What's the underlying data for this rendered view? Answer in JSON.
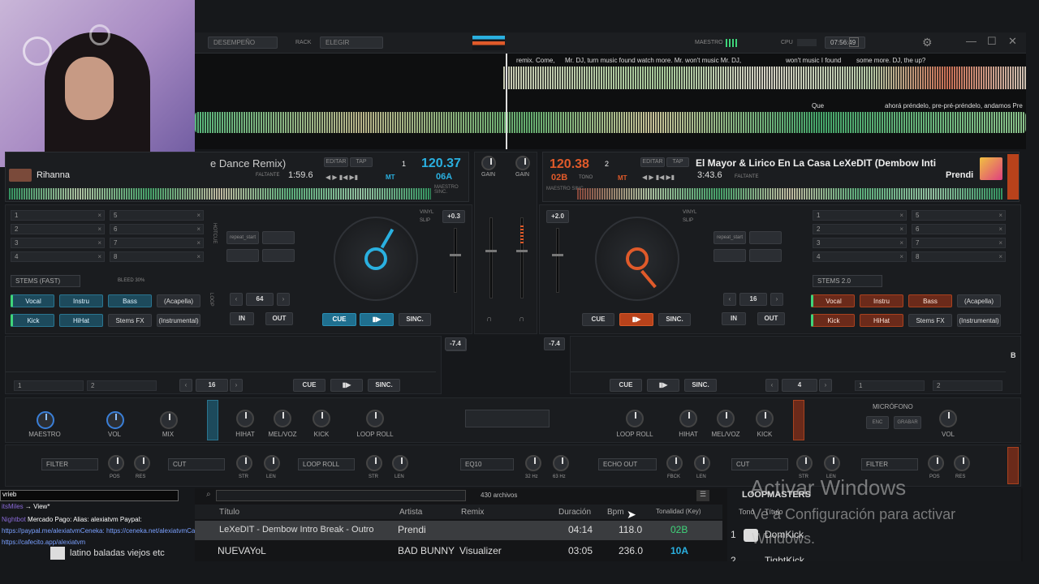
{
  "topbar": {
    "perf_dropdown": "DESEMPEÑO",
    "rack_label": "RACK",
    "rack_dropdown": "ELEGIR",
    "master_label": "MAESTRO",
    "cpu_label": "CPU",
    "clock": "07:56:49"
  },
  "wave_lyrics": {
    "top_left": "remix. Come,",
    "top_2": "Mr. DJ, turn music found watch more. Mr. won't music Mr. DJ,",
    "top_3": "won't music I found",
    "top_4": "some more. DJ, the up?",
    "bottom_left": "Que",
    "bottom_right": "ahorá préndelo, pre-pré-préndelo, andamos Pre"
  },
  "deck_left": {
    "title_partial": "e Dance Remix)",
    "artist": "Rihanna",
    "time": "1:59.6",
    "remain_label": "FALTANTE",
    "edit_label": "EDITAR",
    "tap_label": "TAP",
    "bpm": "120.37",
    "deck_num": "1",
    "key": "06A",
    "mt": "MT",
    "pitch": "+0.3",
    "vinyl": "VINYL",
    "slip": "SLIP",
    "master_sync": "MAESTRO SINC.",
    "cues": [
      "1",
      "2",
      "3",
      "4",
      "5",
      "6",
      "7",
      "8"
    ],
    "stems_dropdown": "STEMS (FAST)",
    "bleed": "BLEED 30%",
    "stems": [
      "Vocal",
      "Instru",
      "Bass",
      "(Acapella)",
      "Kick",
      "HiHat",
      "Stems FX",
      "(Instrumental)"
    ],
    "loop_value": "64",
    "in": "IN",
    "out": "OUT",
    "cue": "CUE",
    "play": "▮▶",
    "sync": "SINC.",
    "hotcue_label": "HOTCUE",
    "loop_label": "LOOP",
    "pad_label": "repeat_start",
    "gain_label": "GAIN"
  },
  "deck_right": {
    "title": "El Mayor & Lirico En La Casa  LeXeDIT (Dembow Inti",
    "artist": "Prendi",
    "time": "3:43.6",
    "remain_label": "FALTANTE",
    "edit_label": "EDITAR",
    "tap_label": "TAP",
    "bpm": "120.38",
    "deck_num": "2",
    "key": "02B",
    "tono": "TONO",
    "mt": "MT",
    "pitch": "+2.0",
    "vinyl": "VINYL",
    "slip": "SLIP",
    "master_sync": "MAESTRO SINC.",
    "cues": [
      "1",
      "2",
      "3",
      "4",
      "5",
      "6",
      "7",
      "8"
    ],
    "stems_dropdown": "STEMS 2.0",
    "stems": [
      "Vocal",
      "Instru",
      "Bass",
      "(Acapella)",
      "Kick",
      "HiHat",
      "Stems FX",
      "(Instrumental)"
    ],
    "loop_value": "16",
    "in": "IN",
    "out": "OUT",
    "cue": "CUE",
    "play": "▮▶",
    "sync": "SINC.",
    "gain_label": "GAIN",
    "pad_label": "repeat_start"
  },
  "lower": {
    "left_pitch": "-7.4",
    "right_pitch": "-7.4",
    "left_loop": "16",
    "right_loop": "4",
    "cue": "CUE",
    "play": "▮▶",
    "sync": "SINC.",
    "deck_b": "B",
    "cues_l": [
      "1",
      "2"
    ],
    "cues_r": [
      "1",
      "2"
    ]
  },
  "mixer": {
    "maestro": "MAESTRO",
    "vol": "VOL",
    "mix": "MIX",
    "hihat": "HIHAT",
    "melvoz": "MEL/VOZ",
    "kick": "KICK",
    "loop_roll": "LOOP ROLL",
    "microfono": "MICRÓFONO",
    "enc": "ENC",
    "grabar": "GRABAR",
    "fx_left": [
      "FILTER",
      "CUT",
      "LOOP ROLL"
    ],
    "fx_center": "EQ10",
    "fx_right": [
      "ECHO OUT",
      "CUT",
      "FILTER"
    ],
    "pos": "POS",
    "res": "RES",
    "str": "STR",
    "len": "LEN",
    "hz32": "32 Hz",
    "hz63": "63 Hz",
    "fbck": "FBCK"
  },
  "browser": {
    "file_count": "430 archivos",
    "columns": [
      "Título",
      "Artista",
      "Remix",
      "Duración",
      "Bpm",
      "Tonalidad (Key)"
    ],
    "rows": [
      {
        "title": "LeXeDIT - Dembow Intro Break - Outro",
        "artist": "Prendi",
        "remix": "",
        "duration": "04:14",
        "bpm": "118.0",
        "key": "02B"
      },
      {
        "title": "NUEVAYoL",
        "artist": "BAD BUNNY",
        "remix": "Visualizer",
        "duration": "03:05",
        "bpm": "236.0",
        "key": "10A"
      }
    ],
    "side_title": "LOOPMASTERS",
    "side_cols": [
      "Tono",
      "Título"
    ],
    "side_rows": [
      {
        "num": "1",
        "title": "DomKick"
      },
      {
        "num": "2",
        "title": "TightKick"
      }
    ]
  },
  "chat": {
    "title_input": "vrieb",
    "lines": [
      {
        "user": "itsMiles",
        "text": "→ View*"
      },
      {
        "user": "Nightbot",
        "text": "Mercado Pago: Alias: alexiatvm Paypal:"
      },
      {
        "user": "",
        "text": "https://paypal.me/alexiatvmCeneka: https://ceneka.net/alexiatvmCafecito:"
      },
      {
        "user": "",
        "text": "https://cafecito.app/alexiatvm"
      },
      {
        "user": "",
        "text": "latino baladas viejos etc"
      }
    ]
  },
  "watermark": {
    "line1": "Activar Windows",
    "line2": "Ve a Configuración para activar",
    "line3": "Windows."
  },
  "colors": {
    "accent_blue": "#2ab0e0",
    "accent_orange": "#e05a2a",
    "bg": "#16181b"
  }
}
